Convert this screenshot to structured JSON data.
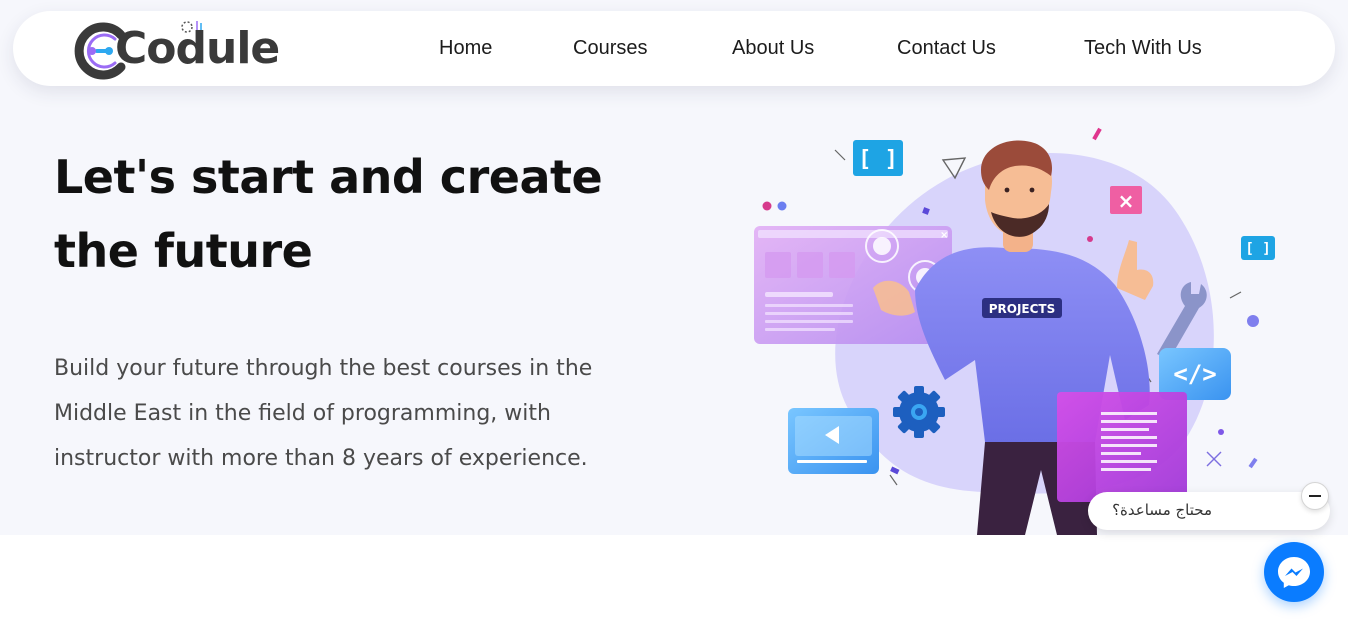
{
  "brand": {
    "logo_text": "Codule",
    "colors": {
      "accent_purple": "#9b6cf5",
      "accent_blue": "#2da8f0",
      "text_dark": "#3a3a3a"
    }
  },
  "nav": {
    "items": [
      {
        "label": "Home"
      },
      {
        "label": "Courses"
      },
      {
        "label": "About Us"
      },
      {
        "label": "Contact Us"
      },
      {
        "label": "Tech With Us"
      }
    ]
  },
  "hero": {
    "title": "Let's start and create the future",
    "description": "Build your future through the best courses in the Middle East in the field of programming, with instructor with more than 8 years of experience.",
    "illustration": {
      "shirt_text": "PROJECTS",
      "code_icon_text": "</>",
      "bracket_text": "[ ]",
      "icons": [
        "close-icon",
        "gear-icon",
        "wrench-icon",
        "play-icon"
      ]
    }
  },
  "chat_widget": {
    "help_text": "محتاج مساعدة؟",
    "minimize_icon": "minus-icon",
    "messenger_icon": "messenger-icon",
    "messenger_color": "#0a7cff"
  }
}
